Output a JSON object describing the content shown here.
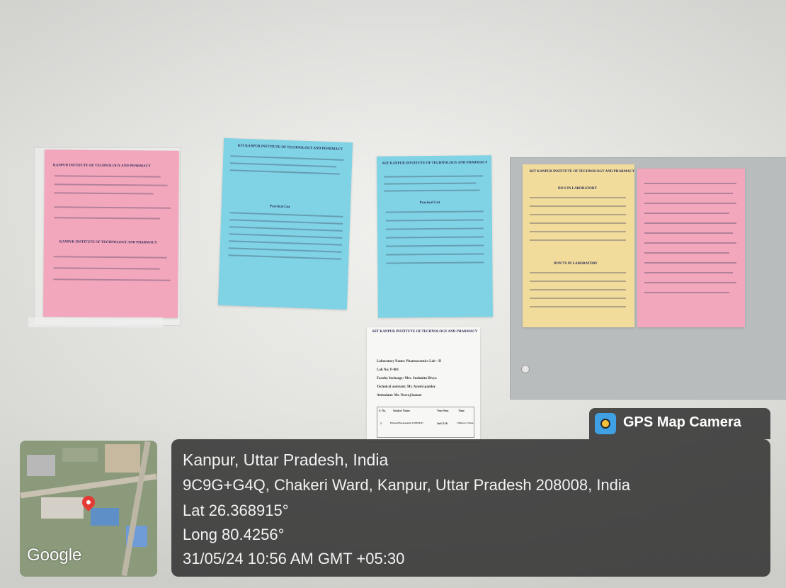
{
  "notices": {
    "pink_left_title_1": "KANPUR INSTITUTE OF TECHNOLOGY AND PHARMACY",
    "pink_left_title_2": "KANPUR INSTITUTE OF TECHNOLOGY AND PHARMACY",
    "blue_1_header": "KIT KANPUR INSTITUTE OF TECHNOLOGY AND PHARMACY",
    "blue_1_list_title": "Practical List",
    "blue_2_header": "KIT KANPUR INSTITUTE OF TECHNOLOGY AND PHARMACY",
    "blue_2_list_title": "Practical List",
    "white_header": "KIT KANPUR INSTITUTE OF TECHNOLOGY AND PHARMACY",
    "white_lab_name": "Laboratory Name: Pharmaceutics Lab - II",
    "white_lab_no": "Lab No: P-001",
    "white_faculty": "Faculty Incharge: Mrs. Sushmita Divya",
    "white_technical": "Technical assistant: Mr. Ayushi pandey",
    "white_attendant": "Attendant: Mr. Neeraj kumar",
    "white_table_headers": [
      "S. No.",
      "Subject Name",
      "Year/Sem",
      "Time"
    ],
    "white_table_row": [
      "1",
      "Physical Pharmaceutics II (BP403T)",
      "2nd/ 4 th",
      "1:00pm to 2:15pm"
    ],
    "yellow_header": "KIT KANPUR INSTITUTE OF TECHNOLOGY AND PHARMACY",
    "yellow_section_1": "DO'S IN LABORATORY",
    "yellow_section_2": "DON'TS IN LABORATORY"
  },
  "overlay": {
    "app_name": "GPS Map Camera",
    "city_line": "Kanpur, Uttar Pradesh, India",
    "address_line": "9C9G+G4Q, Chakeri Ward, Kanpur, Uttar Pradesh 208008, India",
    "lat_line": "Lat 26.368915°",
    "long_line": "Long 80.4256°",
    "datetime_line": "31/05/24 10:56 AM GMT +05:30",
    "map_logo": "Google"
  },
  "colors": {
    "pink_paper": "#f3a7bd",
    "blue_paper": "#7fd3e4",
    "yellow_paper": "#f1dc9c",
    "overlay_bg": "#282828"
  }
}
